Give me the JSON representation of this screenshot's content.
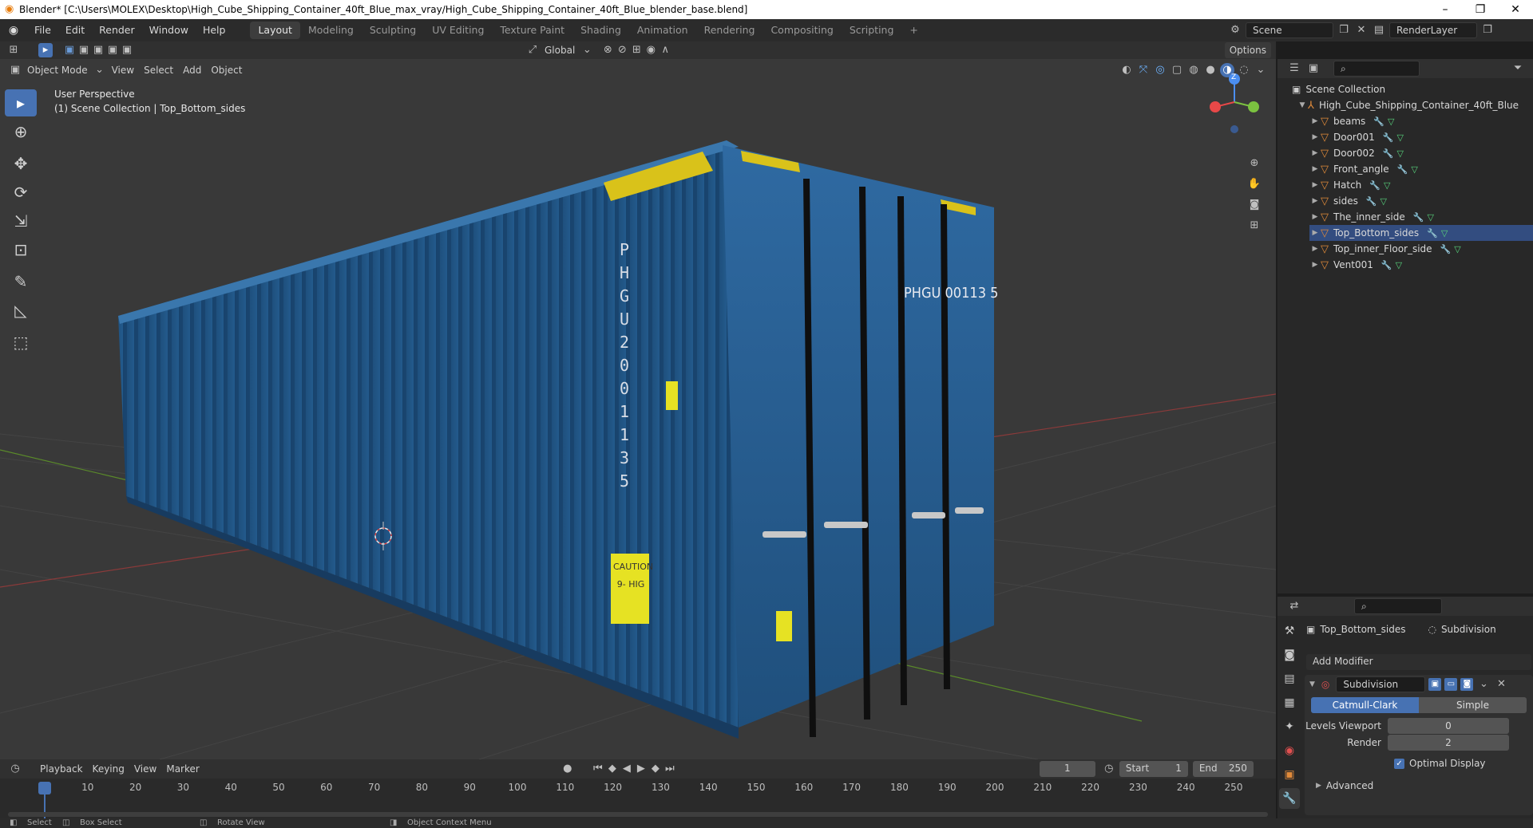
{
  "window": {
    "title": "Blender* [C:\\Users\\MOLEX\\Desktop\\High_Cube_Shipping_Container_40ft_Blue_max_vray/High_Cube_Shipping_Container_40ft_Blue_blender_base.blend]",
    "minimize": "–",
    "maximize": "❐",
    "close": "✕"
  },
  "menu": {
    "items": [
      "File",
      "Edit",
      "Render",
      "Window",
      "Help"
    ]
  },
  "workspaces": [
    "Layout",
    "Modeling",
    "Sculpting",
    "UV Editing",
    "Texture Paint",
    "Shading",
    "Animation",
    "Rendering",
    "Compositing",
    "Scripting"
  ],
  "scene": {
    "name": "Scene",
    "view_layer": "RenderLayer"
  },
  "viewport_header": {
    "mode": "Object Mode",
    "menus": [
      "View",
      "Select",
      "Add",
      "Object"
    ],
    "orientation": "Global",
    "options": "Options"
  },
  "viewport": {
    "perspective": "User Perspective",
    "collection_info": "(1) Scene Collection | Top_Bottom_sides",
    "gizmo_z": "Z",
    "container_text": {
      "side_code": "PHGU 200113 5",
      "door_code": "PHGU 00113 5",
      "caution": "CAUTION 9- HIG"
    }
  },
  "outliner": {
    "root": "Scene Collection",
    "object": "High_Cube_Shipping_Container_40ft_Blue",
    "children": [
      "beams",
      "Door001",
      "Door002",
      "Front_angle",
      "Hatch",
      "sides",
      "The_inner_side",
      "Top_Bottom_sides",
      "Top_inner_Floor_side",
      "Vent001"
    ]
  },
  "properties": {
    "object": "Top_Bottom_sides",
    "modifier_context": "Subdivision",
    "add_modifier": "Add Modifier",
    "modifier": {
      "name": "Subdivision",
      "mode_a": "Catmull-Clark",
      "mode_b": "Simple",
      "levels_viewport_label": "Levels Viewport",
      "levels_viewport": "0",
      "render_label": "Render",
      "render": "2",
      "optimal_display": "Optimal Display",
      "advanced": "Advanced"
    }
  },
  "timeline": {
    "menus": [
      "Playback",
      "Keying",
      "View",
      "Marker"
    ],
    "current_frame": "1",
    "start_label": "Start",
    "start": "1",
    "end_label": "End",
    "end": "250",
    "ticks": [
      "1",
      "10",
      "20",
      "30",
      "40",
      "50",
      "60",
      "70",
      "80",
      "90",
      "100",
      "110",
      "120",
      "130",
      "140",
      "150",
      "160",
      "170",
      "180",
      "190",
      "200",
      "210",
      "220",
      "230",
      "240",
      "250"
    ]
  },
  "status": {
    "items": [
      "Select",
      "Box Select",
      "Rotate View",
      "Object Context Menu"
    ]
  }
}
